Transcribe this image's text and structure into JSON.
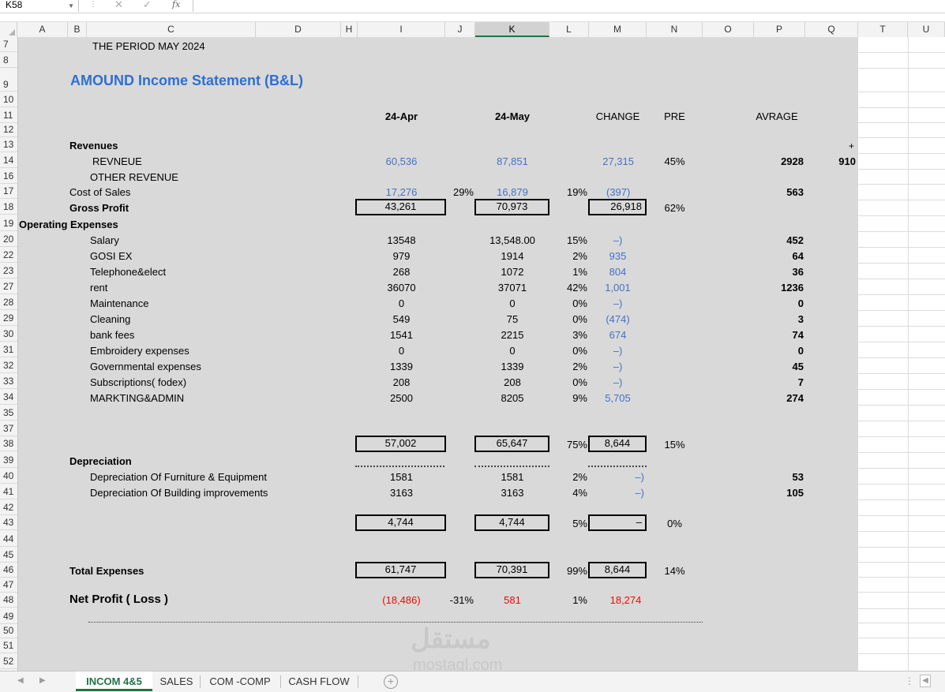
{
  "formula_bar": {
    "name_box": "K58",
    "cancel_icon": "✕",
    "enter_icon": "✓",
    "fx_label": "fx",
    "formula": ""
  },
  "columns": [
    "A",
    "B",
    "C",
    "D",
    "H",
    "I",
    "J",
    "K",
    "L",
    "M",
    "N",
    "O",
    "P",
    "Q",
    "T",
    "U"
  ],
  "selected_column": "K",
  "rows": [
    "7",
    "8",
    "9",
    "10",
    "11",
    "12",
    "13",
    "14",
    "16",
    "17",
    "18",
    "19",
    "20",
    "22",
    "23",
    "27",
    "28",
    "29",
    "30",
    "31",
    "32",
    "33",
    "34",
    "35",
    "37",
    "38",
    "39",
    "40",
    "41",
    "42",
    "43",
    "44",
    "45",
    "46",
    "47",
    "48",
    "49",
    "50",
    "51",
    "52"
  ],
  "sheet": {
    "period_label": "THE PERIOD   MAY 2024",
    "title": "AMOUND Income Statement (B&L)",
    "headers": {
      "apr": "24-Apr",
      "may": "24-May",
      "change": "CHANGE",
      "pre": "PRE",
      "avrage": "AVRAGE"
    },
    "revenues_label": "Revenues",
    "plus_sign": "+",
    "revenue": {
      "label": "REVNEUE",
      "apr": "60,536",
      "may": "87,851",
      "change": "27,315",
      "pre": "45%",
      "avg": "2928",
      "q": "910"
    },
    "other_revenue": {
      "label": "OTHER REVENUE"
    },
    "cost_of_sales": {
      "label": "Cost of Sales",
      "apr": "17,276",
      "apr_pct": "29%",
      "may": "16,879",
      "may_pct": "19%",
      "change": "(397)",
      "avg": "563"
    },
    "gross_profit": {
      "label": "Gross Profit",
      "apr": "43,261",
      "may": "70,973",
      "change": "26,918",
      "pre": "62%"
    },
    "opex_label": "Operating Expenses",
    "expenses": [
      {
        "label": "Salary",
        "apr": "13548",
        "may": "13,548.00",
        "pct": "15%",
        "change": "–)",
        "avg": "452"
      },
      {
        "label": "GOSI EX",
        "apr": "979",
        "may": "1914",
        "pct": "2%",
        "change": "935",
        "avg": "64"
      },
      {
        "label": "Telephone&elect",
        "apr": "268",
        "may": "1072",
        "pct": "1%",
        "change": "804",
        "avg": "36"
      },
      {
        "label": "rent",
        "apr": "36070",
        "may": "37071",
        "pct": "42%",
        "change": "1,001",
        "avg": "1236"
      },
      {
        "label": "Maintenance",
        "apr": "0",
        "may": "0",
        "pct": "0%",
        "change": "–)",
        "avg": "0"
      },
      {
        "label": "Cleaning",
        "apr": "549",
        "may": "75",
        "pct": "0%",
        "change": "(474)",
        "avg": "3"
      },
      {
        "label": "bank fees",
        "apr": "1541",
        "may": "2215",
        "pct": "3%",
        "change": "674",
        "avg": "74"
      },
      {
        "label": "Embroidery expenses",
        "apr": "0",
        "may": "0",
        "pct": "0%",
        "change": "–)",
        "avg": "0"
      },
      {
        "label": "Governmental expenses",
        "apr": "1339",
        "may": "1339",
        "pct": "2%",
        "change": "–)",
        "avg": "45"
      },
      {
        "label": "Subscriptions( fodex)",
        "apr": "208",
        "may": "208",
        "pct": "0%",
        "change": "–)",
        "avg": "7"
      },
      {
        "label": "MARKTING&ADMIN",
        "apr": "2500",
        "may": "8205",
        "pct": "9%",
        "change": "5,705",
        "avg": "274"
      }
    ],
    "opex_total": {
      "apr": "57,002",
      "may": "65,647",
      "pct": "75%",
      "change": "8,644",
      "pre": "15%"
    },
    "depreciation_label": "Depreciation",
    "depreciation": [
      {
        "label": "Depreciation Of Furniture &  Equipment",
        "apr": "1581",
        "may": "1581",
        "pct": "2%",
        "change": "–)",
        "avg": "53"
      },
      {
        "label": "Depreciation Of Building improvements",
        "apr": "3163",
        "may": "3163",
        "pct": "4%",
        "change": "–)",
        "avg": "105"
      }
    ],
    "dep_total": {
      "apr": "4,744",
      "may": "4,744",
      "pct": "5%",
      "change": "–",
      "pre": "0%"
    },
    "total_expenses": {
      "label": "Total Expenses",
      "apr": "61,747",
      "may": "70,391",
      "pct": "99%",
      "change": "8,644",
      "pre": "14%"
    },
    "net_profit": {
      "label": "Net Profit ( Loss )",
      "apr": "(18,486)",
      "apr_pct": "-31%",
      "may": "581",
      "may_pct": "1%",
      "change": "18,274"
    }
  },
  "tabs": [
    "INCOM 4&5",
    "SALES",
    "COM -COMP",
    "CASH FLOW"
  ],
  "active_tab": "INCOM 4&5",
  "watermark": {
    "arabic": "مستقل",
    "latin": "mostaql.com"
  },
  "colors": {
    "accent": "#217346",
    "blue_text": "#4472c4",
    "title_blue": "#2f6fd0",
    "negative": "#ff0000",
    "sheet_bg": "#d9d9d9"
  }
}
